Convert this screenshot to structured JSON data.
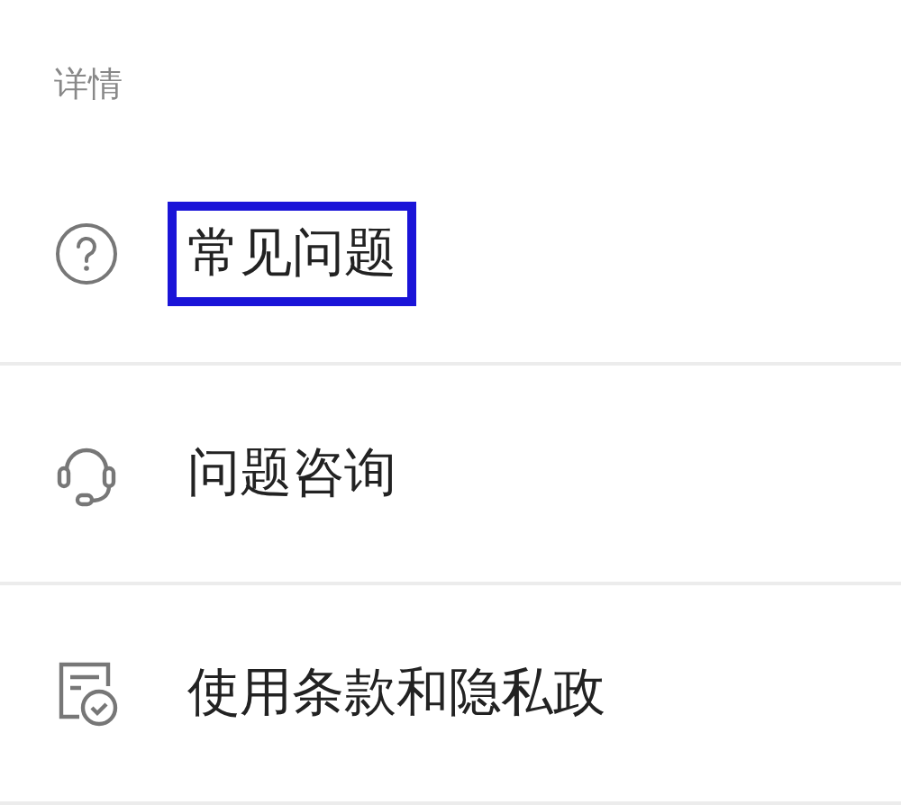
{
  "section": {
    "title": "详情"
  },
  "items": [
    {
      "kind": "question",
      "label": "常见问题",
      "highlighted": true
    },
    {
      "kind": "headset",
      "label": "问题咨询",
      "highlighted": false
    },
    {
      "kind": "document",
      "label": "使用条款和隐私政",
      "highlighted": false
    }
  ]
}
